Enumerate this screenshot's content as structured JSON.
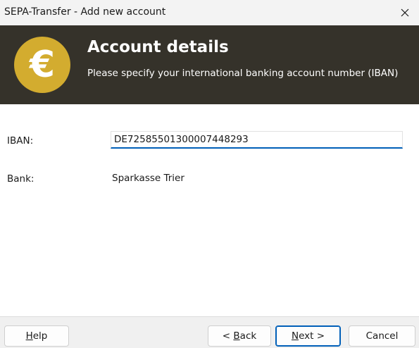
{
  "window": {
    "title": "SEPA-Transfer - Add new account",
    "close_icon": "close-icon"
  },
  "banner": {
    "icon": "euro-icon",
    "icon_glyph": "€",
    "icon_color": "#d3ac2f",
    "background_color": "#35322a",
    "title": "Account details",
    "subtitle": "Please specify your international banking account number (IBAN)"
  },
  "form": {
    "iban_label": "IBAN:",
    "iban_value": "DE72585501300007448293",
    "bank_label": "Bank:",
    "bank_value": "Sparkasse Trier"
  },
  "footer": {
    "help": {
      "mnemonic": "H",
      "rest": "elp"
    },
    "back": {
      "prefix": "< ",
      "mnemonic": "B",
      "rest": "ack"
    },
    "next": {
      "mnemonic": "N",
      "rest": "ext >"
    },
    "cancel": "Cancel",
    "accent_color": "#005fb8"
  }
}
